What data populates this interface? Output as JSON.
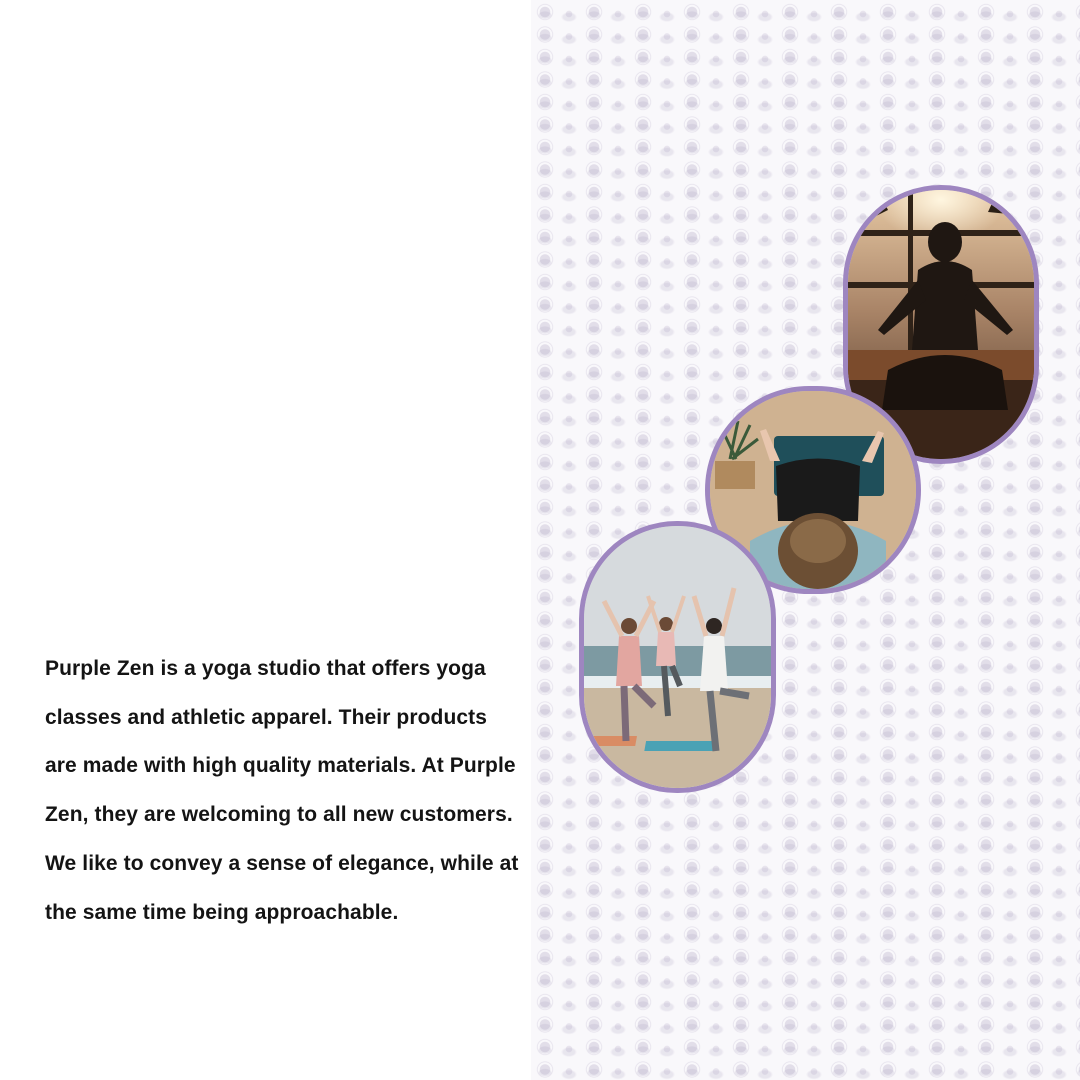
{
  "description": {
    "text": "Purple Zen is a yoga studio that offers yoga classes and athletic apparel. Their products are made with high quality materials. At Purple Zen, they are welcoming to all new customers. We like to convey a sense of elegance, while at the same time being approachable."
  },
  "colors": {
    "frame_border": "#9e86c0",
    "pattern_motif": "#b2a8c4",
    "text": "#141414",
    "background": "#ffffff"
  },
  "icons": {
    "pattern_motif": "lotus-icon"
  }
}
